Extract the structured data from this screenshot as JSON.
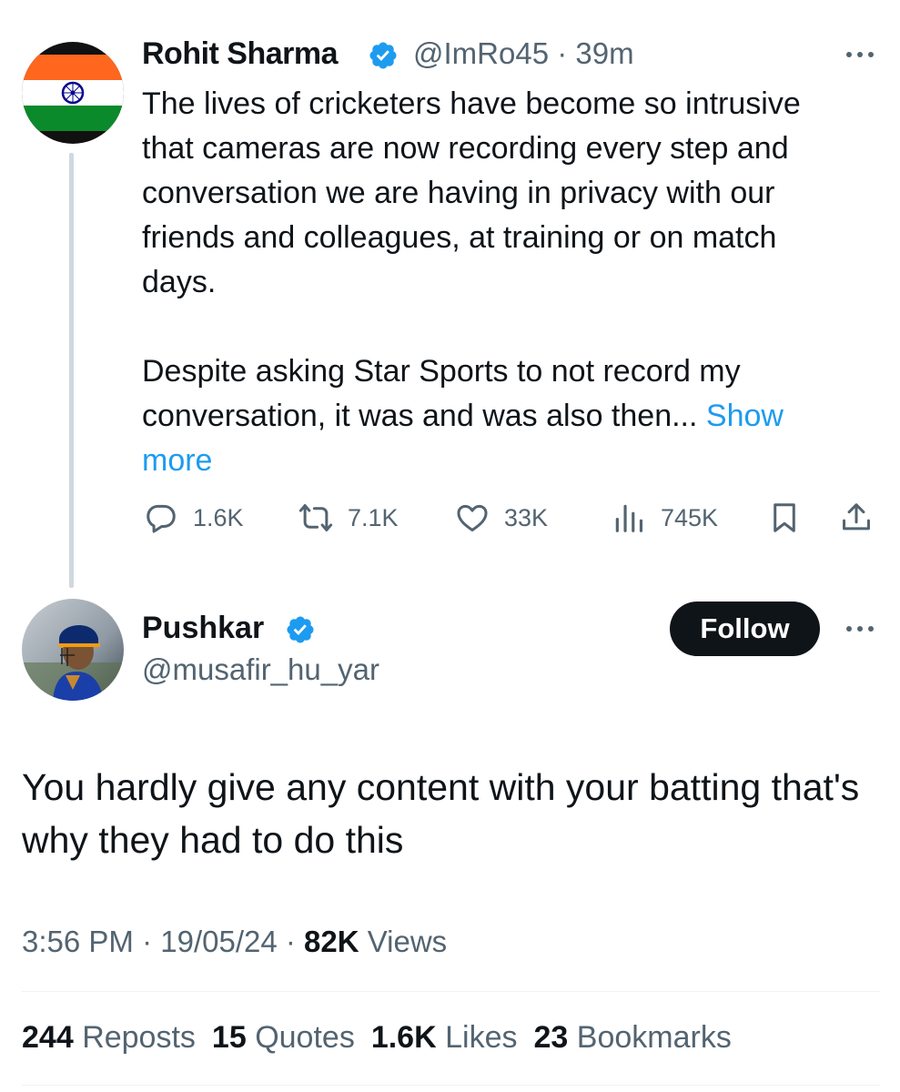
{
  "parent_tweet": {
    "display_name": "Rohit Sharma",
    "handle": "@ImRo45",
    "separator": " · ",
    "time": "39m",
    "text": "The lives of cricketers have become so intrusive\nthat cameras are now recording every step and\nconversation we are having in privacy with our\nfriends and colleagues, at training or on match\ndays.\n\nDespite asking Star Sports to not record my\nconversation, it was and was also then... ",
    "show_more": "Show\nmore",
    "actions": {
      "replies": "1.6K",
      "reposts": "7.1K",
      "likes": "33K",
      "views": "745K"
    },
    "icons": [
      "verified-badge-icon",
      "more-icon",
      "reply-icon",
      "repost-icon",
      "like-icon",
      "views-icon",
      "bookmark-icon",
      "share-icon"
    ]
  },
  "reply_tweet": {
    "display_name": "Pushkar",
    "handle": "@musafir_hu_yar",
    "follow_label": "Follow",
    "text": "You hardly give any content with your batting that's why they had to do this",
    "time": "3:56 PM",
    "date": "19/05/24",
    "views_count": "82K",
    "views_label": "Views",
    "stats": {
      "reposts_count": "244",
      "reposts_label": "Reposts",
      "quotes_count": "15",
      "quotes_label": "Quotes",
      "likes_count": "1.6K",
      "likes_label": "Likes",
      "bookmarks_count": "23",
      "bookmarks_label": "Bookmarks"
    }
  },
  "colors": {
    "link": "#1d9bf0",
    "secondary_text": "#536471",
    "primary_text": "#0f1419",
    "verified": "#1d9bf0",
    "flag_saffron": "#ff671f",
    "flag_green": "#0a8a2a",
    "chakra": "#06038d"
  }
}
